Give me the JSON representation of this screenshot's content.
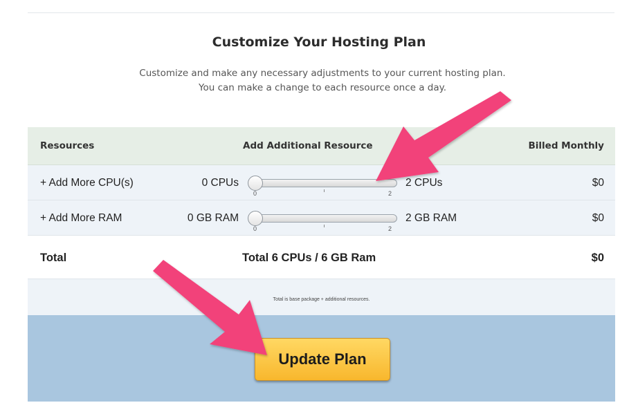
{
  "header": {
    "title": "Customize Your Hosting Plan",
    "subtitle_line1": "Customize and make any necessary adjustments to your current hosting plan.",
    "subtitle_line2": "You can make a change to each resource once a day."
  },
  "table": {
    "columns": [
      "Resources",
      "Add Additional Resource",
      "Billed Monthly"
    ],
    "rows": [
      {
        "label": "+ Add More CPU(s)",
        "min_label": "0 CPUs",
        "max_label": "2 CPUs",
        "scale_min": "0",
        "scale_max": "2",
        "value": 0,
        "price": "$0"
      },
      {
        "label": "+ Add More RAM",
        "min_label": "0 GB RAM",
        "max_label": "2 GB RAM",
        "scale_min": "0",
        "scale_max": "2",
        "value": 0,
        "price": "$0"
      }
    ],
    "total": {
      "label": "Total",
      "summary": "Total 6 CPUs / 6 GB Ram",
      "price": "$0"
    },
    "note": "Total is base package + additional resources."
  },
  "actions": {
    "update_label": "Update Plan"
  },
  "colors": {
    "header_row_bg": "#e6eee6",
    "resource_row_bg": "#eef3f8",
    "action_bar_bg": "#a9c6df",
    "button_gradient_top": "#ffd863",
    "button_gradient_bottom": "#f8b72d",
    "annotation_arrow": "#f2427a"
  }
}
